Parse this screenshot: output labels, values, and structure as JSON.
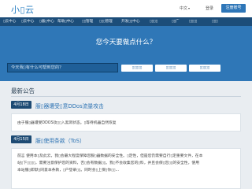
{
  "header": {
    "logo": "小▯云",
    "language": "中文",
    "login": "登录",
    "account_button": "注册账号"
  },
  "nav": {
    "items": [
      "▯云中心",
      "▯云中心",
      "▯器▯中心",
      "帮助▯中心",
      "▯▯管理",
      "▯▯▯管理",
      "开发▯▯中心",
      "▯▯▯▯",
      "▯▯广",
      "▯▯▯▯",
      "▯▯▯"
    ]
  },
  "hero": {
    "title": "您今天要做点什么？",
    "search_placeholder": "今天我▯有什么可帮到您的？",
    "buttons": [
      "▯▯▯▯▯",
      "▯▯▯▯▯",
      "▯▯▯▯▯"
    ]
  },
  "announcements": {
    "title": "最新公告",
    "posts": [
      {
        "date": "4月18日",
        "title": "服▯器遭受▯意DDos流量攻击",
        "body": "由于服▯器遭受DDOS攻▯▯入黑洞状态。▯等待机器自然恢复"
      },
      {
        "date": "4月15日",
        "title": "服▯使用条款（ToS）",
        "body_lines": [
          "前言 使用本▯及此云，我▯会最大程度保障您服▯器数据的安全性。▯定性，但是您仍需要自行▯定重要文件，在本",
          "站▯下▯▯▯▯，需要注意保护您的资料，否▯会有数据▯▯。我▯不会收集您的▯料，并且会保▯您▯▯的安全性，使用",
          "本站服▯即默▯同意本条款，▯户登录▯▯。同时会▯上保▯你▯▯..."
        ]
      }
    ]
  }
}
